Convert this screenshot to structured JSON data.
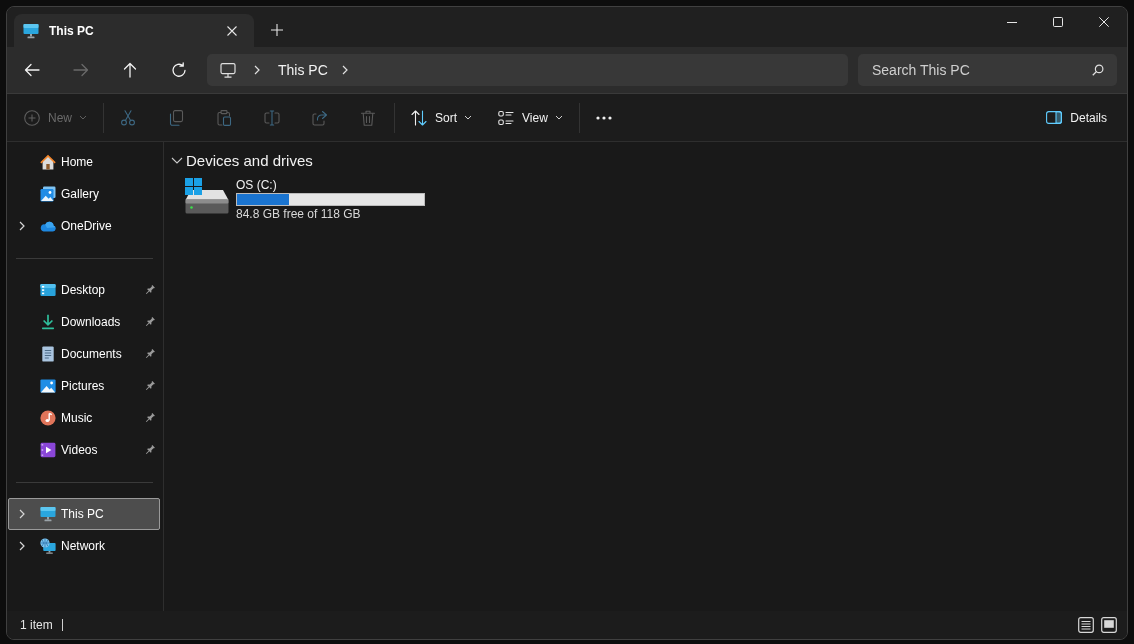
{
  "window": {
    "tabs": [
      {
        "title": "This PC",
        "selected": true
      }
    ],
    "controls": [
      {
        "kind": "minimize"
      },
      {
        "kind": "maximize"
      },
      {
        "kind": "close"
      }
    ]
  },
  "navigation": {
    "buttons": [
      {
        "kind": "back",
        "disabled": false
      },
      {
        "kind": "forward",
        "disabled": true
      },
      {
        "kind": "up",
        "disabled": false
      },
      {
        "kind": "refresh",
        "disabled": false
      }
    ],
    "address": {
      "crumbs": [
        "This PC"
      ]
    },
    "search": {
      "placeholder": "Search This PC"
    }
  },
  "command_bar": {
    "new": {
      "label": "New",
      "disabled": true
    },
    "actions": [
      {
        "kind": "cut",
        "disabled": true
      },
      {
        "kind": "copy",
        "disabled": true
      },
      {
        "kind": "paste",
        "disabled": true
      },
      {
        "kind": "rename",
        "disabled": true
      },
      {
        "kind": "share",
        "disabled": true
      },
      {
        "kind": "delete",
        "disabled": true
      }
    ],
    "menus": [
      {
        "kind": "sort",
        "label": "Sort"
      },
      {
        "kind": "view",
        "label": "View"
      }
    ],
    "details": {
      "label": "Details"
    }
  },
  "sidebar": {
    "groups": [
      {
        "items": [
          {
            "label": "Home",
            "kind": "home",
            "expandable": false,
            "pinned": false,
            "selected": false
          },
          {
            "label": "Gallery",
            "kind": "gallery",
            "expandable": false,
            "pinned": false,
            "selected": false
          },
          {
            "label": "OneDrive",
            "kind": "onedrive",
            "expandable": true,
            "pinned": false,
            "selected": false
          }
        ]
      },
      {
        "items": [
          {
            "label": "Desktop",
            "kind": "desktop",
            "expandable": false,
            "pinned": true,
            "selected": false
          },
          {
            "label": "Downloads",
            "kind": "downloads",
            "expandable": false,
            "pinned": true,
            "selected": false
          },
          {
            "label": "Documents",
            "kind": "documents",
            "expandable": false,
            "pinned": true,
            "selected": false
          },
          {
            "label": "Pictures",
            "kind": "pictures",
            "expandable": false,
            "pinned": true,
            "selected": false
          },
          {
            "label": "Music",
            "kind": "music",
            "expandable": false,
            "pinned": true,
            "selected": false
          },
          {
            "label": "Videos",
            "kind": "videos",
            "expandable": false,
            "pinned": true,
            "selected": false
          }
        ]
      },
      {
        "items": [
          {
            "label": "This PC",
            "kind": "computer",
            "expandable": true,
            "pinned": false,
            "selected": true
          },
          {
            "label": "Network",
            "kind": "network",
            "expandable": true,
            "pinned": false,
            "selected": false
          }
        ]
      }
    ]
  },
  "content": {
    "sections": [
      {
        "title": "Devices and drives",
        "expanded": true,
        "drives": [
          {
            "name": "OS (C:)",
            "level": 0.28,
            "free_space": "84.8 GB free of 118 GB"
          }
        ]
      }
    ]
  },
  "status_bar": {
    "item_count": "1 item",
    "view_buttons": [
      {
        "kind": "details"
      },
      {
        "kind": "large_icons"
      }
    ]
  }
}
